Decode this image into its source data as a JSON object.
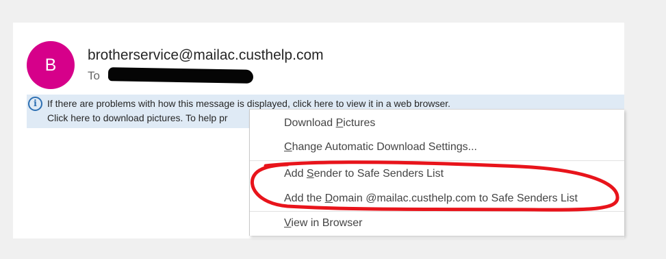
{
  "message": {
    "avatar_initial": "B",
    "sender_email": "brotherservice@mailac.custhelp.com",
    "to_label": "To"
  },
  "infobar": {
    "icon": "info-icon",
    "line1": "If there are problems with how this message is displayed, click here to view it in a web browser.",
    "line2": "Click here to download pictures. To help pr"
  },
  "context_menu": {
    "items": [
      {
        "before": "Download ",
        "key": "P",
        "after": "ictures"
      },
      {
        "before": "",
        "key": "C",
        "after": "hange Automatic Download Settings..."
      },
      {
        "before": "Add ",
        "key": "S",
        "after": "ender to Safe Senders List"
      },
      {
        "before": "Add the ",
        "key": "D",
        "after": "omain @mailac.custhelp.com to Safe Senders List"
      },
      {
        "before": "",
        "key": "V",
        "after": "iew in Browser"
      }
    ]
  },
  "colors": {
    "avatar": "#d6008a",
    "info_bar": "#dfeaf5",
    "info_icon": "#2d6fb2",
    "annotation_circle": "#e8141b"
  }
}
